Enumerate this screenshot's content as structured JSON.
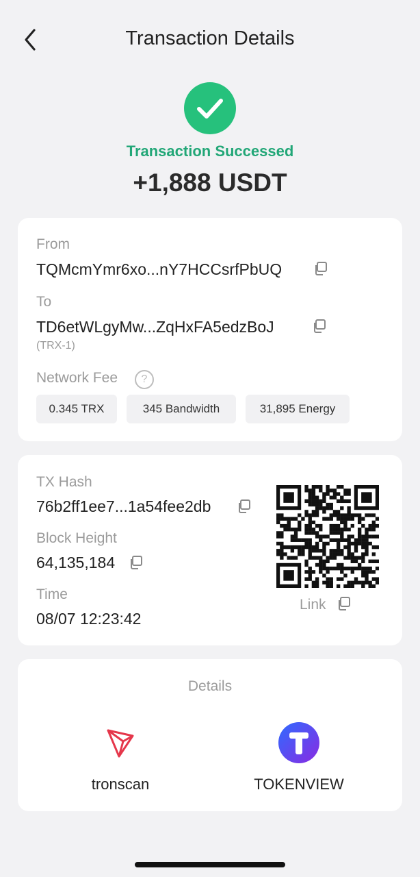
{
  "header": {
    "title": "Transaction Details",
    "back_icon": "chevron-left-icon"
  },
  "summary": {
    "status": "Transaction Successed",
    "amount": "+1,888 USDT",
    "status_color": "#26c17c"
  },
  "transfer": {
    "from_label": "From",
    "from_value": "TQMcmYmr6xo...nY7HCCsrfPbUQ",
    "to_label": "To",
    "to_value": "TD6etWLgyMw...ZqHxFA5edzBoJ",
    "to_note": "(TRX-1)",
    "fee_label": "Network Fee",
    "fee_help": "?",
    "fees": [
      "0.345 TRX",
      "345 Bandwidth",
      "31,895 Energy"
    ]
  },
  "tx": {
    "hash_label": "TX Hash",
    "hash_value": "76b2ff1ee7...1a54fee2db",
    "block_label": "Block Height",
    "block_value": "64,135,184",
    "time_label": "Time",
    "time_value": "08/07 12:23:42",
    "link_label": "Link"
  },
  "explorers": {
    "title": "Details",
    "items": [
      {
        "name": "tronscan",
        "icon": "tronscan-logo-icon"
      },
      {
        "name": "TOKENVIEW",
        "icon": "tokenview-logo-icon"
      }
    ]
  }
}
